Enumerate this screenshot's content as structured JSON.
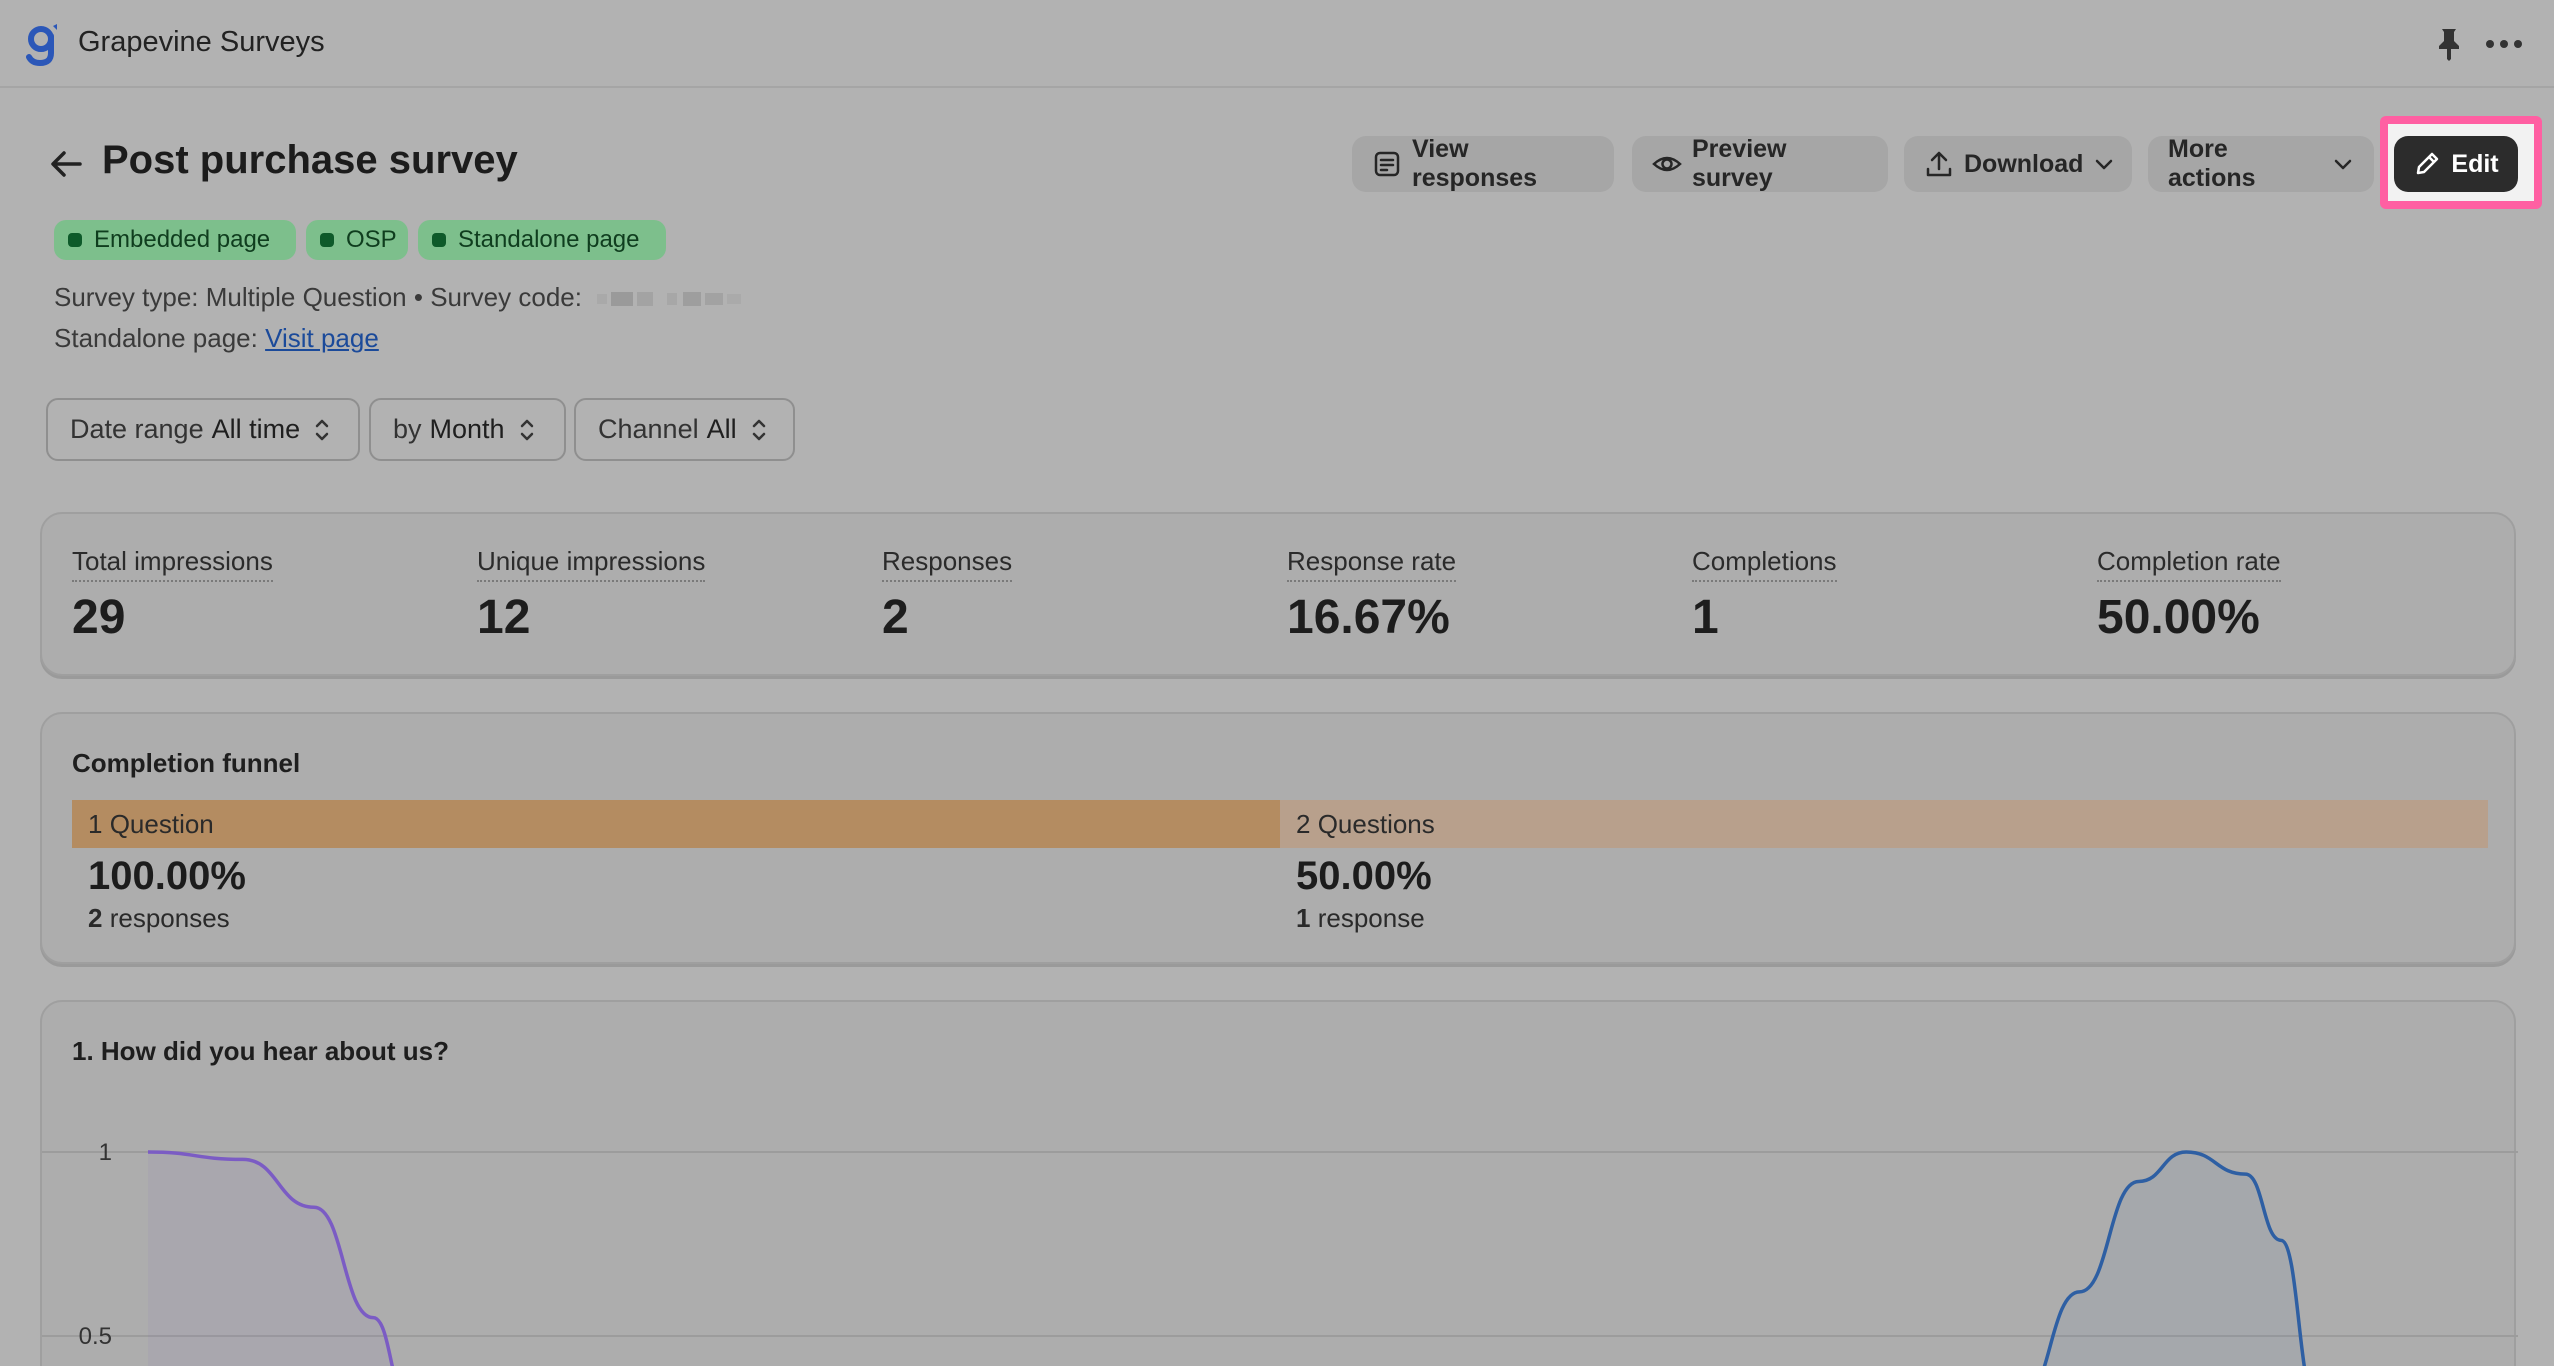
{
  "app": {
    "title": "Grapevine Surveys"
  },
  "header": {
    "title": "Post purchase survey",
    "buttons": {
      "view_responses": "View responses",
      "preview_survey": "Preview survey",
      "download": "Download",
      "more_actions": "More actions",
      "edit": "Edit"
    }
  },
  "badges": [
    "Embedded page",
    "OSP",
    "Standalone page"
  ],
  "meta": {
    "survey_type_label": "Survey type:",
    "survey_type_value": "Multiple Question",
    "separator": "•",
    "survey_code_label": "Survey code:",
    "standalone_label": "Standalone page:",
    "visit_link": "Visit page"
  },
  "filters": {
    "date_range": {
      "label": "Date range",
      "value": "All time"
    },
    "group_by": {
      "label": "by",
      "value": "Month"
    },
    "channel": {
      "label": "Channel",
      "value": "All"
    }
  },
  "metrics": [
    {
      "label": "Total impressions",
      "value": "29"
    },
    {
      "label": "Unique impressions",
      "value": "12"
    },
    {
      "label": "Responses",
      "value": "2"
    },
    {
      "label": "Response rate",
      "value": "16.67%"
    },
    {
      "label": "Completions",
      "value": "1"
    },
    {
      "label": "Completion rate",
      "value": "50.00%"
    }
  ],
  "funnel": {
    "title": "Completion funnel",
    "steps": [
      {
        "count": "1",
        "label": "Question",
        "percent": "100.00%",
        "responses_count": "2",
        "responses_label": "responses"
      },
      {
        "count": "2",
        "label": "Questions",
        "percent": "50.00%",
        "responses_count": "1",
        "responses_label": "response"
      }
    ]
  },
  "question": {
    "title": "1. How did you hear about us?"
  },
  "colors": {
    "accent_highlight": "#ff5fa2",
    "badge_green": "#7dbf8c",
    "funnel_step_1": "#b48c61",
    "funnel_step_2": "#b8a08c",
    "series_purple": "#7b5cc4",
    "series_blue": "#2e5fa3"
  },
  "chart_data": {
    "type": "line",
    "ytick_labels": [
      "1",
      "0.5"
    ],
    "yticks": [
      1,
      0.5
    ],
    "ylim": [
      0,
      1
    ],
    "grid": true,
    "series": [
      {
        "color": "#7b5cc4",
        "points": [
          [
            0.0,
            1.0
          ],
          [
            0.04,
            0.98
          ],
          [
            0.07,
            0.85
          ],
          [
            0.095,
            0.55
          ],
          [
            0.11,
            0.32
          ]
        ]
      },
      {
        "color": "#2e5fa3",
        "points": [
          [
            0.79,
            0.32
          ],
          [
            0.815,
            0.62
          ],
          [
            0.84,
            0.92
          ],
          [
            0.86,
            1.0
          ],
          [
            0.885,
            0.94
          ],
          [
            0.9,
            0.76
          ],
          [
            0.915,
            0.32
          ]
        ]
      }
    ],
    "icons": {
      "logo": "grapevine-g-logo",
      "pin": "pin-icon",
      "more": "more-horizontal-icon",
      "back": "arrow-left-icon",
      "view_responses": "list-icon",
      "preview": "eye-icon",
      "download": "upload-icon",
      "edit": "pencil-icon",
      "select": "chevron-updown-icon"
    }
  }
}
